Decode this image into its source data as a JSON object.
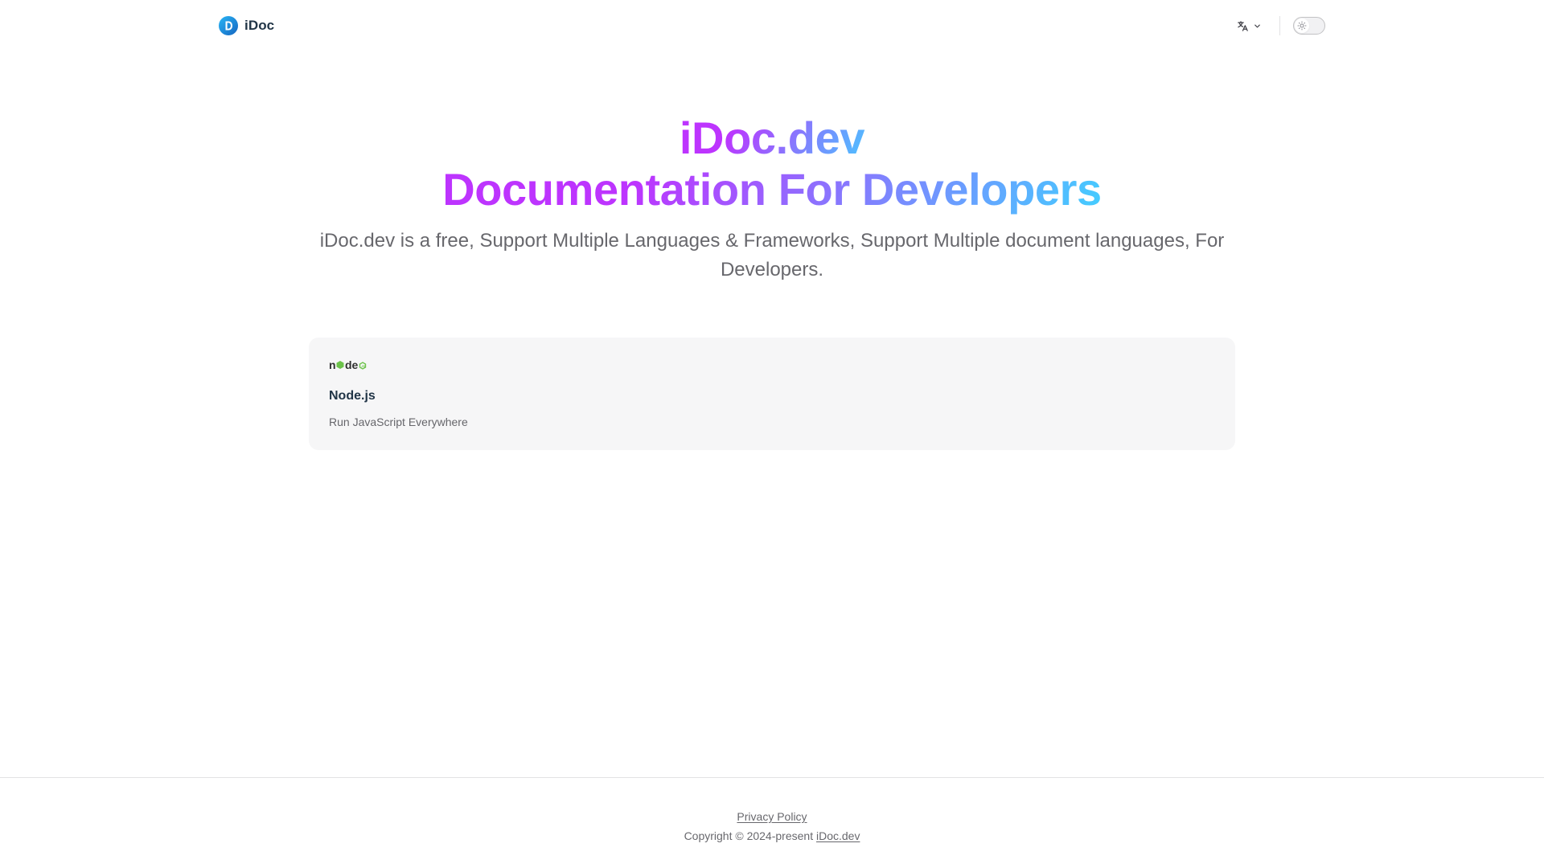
{
  "navbar": {
    "brand": "iDoc",
    "logo_icon": "idoc-logo-icon",
    "language_icon": "translate-icon",
    "language_chevron_icon": "chevron-down-icon",
    "theme_icon": "sun-icon"
  },
  "hero": {
    "name": "iDoc.dev",
    "text": "Documentation For Developers",
    "tagline": "iDoc.dev is a free, Support Multiple Languages & Frameworks, Support Multiple document languages, For Developers."
  },
  "features": [
    {
      "icon": "nodejs-logo-icon",
      "title": "Node.js",
      "details": "Run JavaScript Everywhere"
    }
  ],
  "footer": {
    "privacy_label": "Privacy Policy",
    "copyright_prefix": "Copyright © 2024-present",
    "copyright_link": "iDoc.dev"
  },
  "colors": {
    "gradient_start": "#bd34fe",
    "gradient_end": "#41d1ff",
    "card_background": "#f6f6f7",
    "logo_blue": "#1e88e5",
    "node_green": "#6cc24a"
  }
}
